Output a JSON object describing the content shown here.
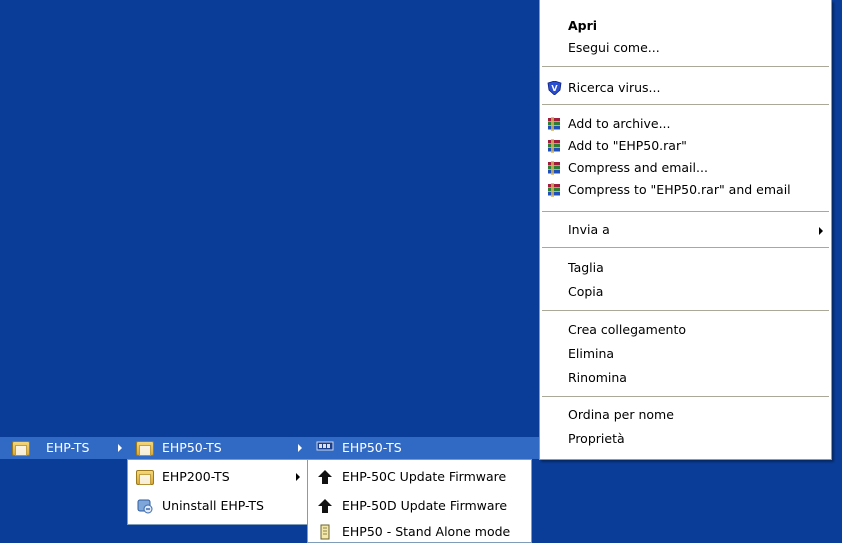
{
  "context_menu": {
    "open": "Apri",
    "run_as": "Esegui come...",
    "virus_scan": "Ricerca virus...",
    "add_archive": "Add to archive...",
    "add_rar": "Add to \"EHP50.rar\"",
    "compress_email": "Compress and email...",
    "compress_rar_email": "Compress to \"EHP50.rar\" and email",
    "send_to": "Invia a",
    "cut": "Taglia",
    "copy": "Copia",
    "create_shortcut": "Crea collegamento",
    "delete": "Elimina",
    "rename": "Rinomina",
    "sort_by_name": "Ordina per nome",
    "properties": "Proprietà"
  },
  "start_menu": {
    "level1": {
      "label": "EHP-TS"
    },
    "level2": [
      {
        "label": "EHP50-TS"
      },
      {
        "label": "EHP200-TS"
      },
      {
        "label": "Uninstall EHP-TS"
      }
    ],
    "level3": [
      {
        "label": "EHP50-TS"
      },
      {
        "label": "EHP-50C Update Firmware"
      },
      {
        "label": "EHP-50D Update Firmware"
      },
      {
        "label": "EHP50 - Stand Alone mode"
      }
    ]
  },
  "colors": {
    "desktop": "#0a3d98",
    "highlight": "#316ac5"
  }
}
